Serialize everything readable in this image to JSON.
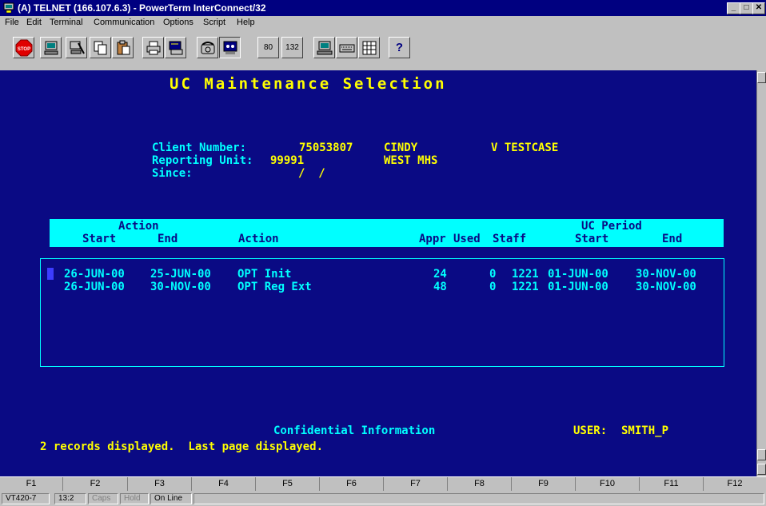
{
  "window": {
    "title": "(A) TELNET (166.107.6.3) - PowerTerm InterConnect/32",
    "minimize": "_",
    "maximize": "□",
    "close": "✕"
  },
  "menu": [
    "File",
    "Edit",
    "Terminal",
    "Communication",
    "Options",
    "Script",
    "Help"
  ],
  "toolbar": {
    "stop_label": "STOP",
    "cols80": "80",
    "cols132": "132",
    "help": "?"
  },
  "screen": {
    "title": "UC Maintenance Selection",
    "client_label": "Client Number:",
    "client_number": "75053807",
    "first_name": "CINDY",
    "last_name": "V TESTCASE",
    "reporting_label": "Reporting Unit:",
    "reporting_unit": "99991",
    "reporting_name": "WEST MHS",
    "since_label": "Since:",
    "since_value": "/  /",
    "headers": {
      "action_group": "Action",
      "start": "Start",
      "end": "End",
      "action": "Action",
      "appr": "Appr",
      "used": "Used",
      "staff": "Staff",
      "uc_group": "UC Period",
      "uc_start": "Start",
      "uc_end": "End"
    },
    "rows": [
      {
        "start": "26-JUN-00",
        "end": "25-JUN-00",
        "action": "OPT Init",
        "appr": "24",
        "used": "0",
        "staff": "1221",
        "uc_start": "01-JUN-00",
        "uc_end": "30-NOV-00"
      },
      {
        "start": "26-JUN-00",
        "end": "30-NOV-00",
        "action": "OPT Reg Ext",
        "appr": "48",
        "used": "0",
        "staff": "1221",
        "uc_start": "01-JUN-00",
        "uc_end": "30-NOV-00"
      }
    ],
    "confidential": "Confidential Information",
    "user_label": "USER:",
    "user": "SMITH_P",
    "status_message": "2 records displayed.  Last page displayed."
  },
  "fkeys": [
    "F1",
    "F2",
    "F3",
    "F4",
    "F5",
    "F6",
    "F7",
    "F8",
    "F9",
    "F10",
    "F11",
    "F12"
  ],
  "statusbar": {
    "terminal_type": "VT420-7",
    "cursor_pos": "13:2",
    "caps": "Caps",
    "hold": "Hold",
    "online": "On Line"
  }
}
